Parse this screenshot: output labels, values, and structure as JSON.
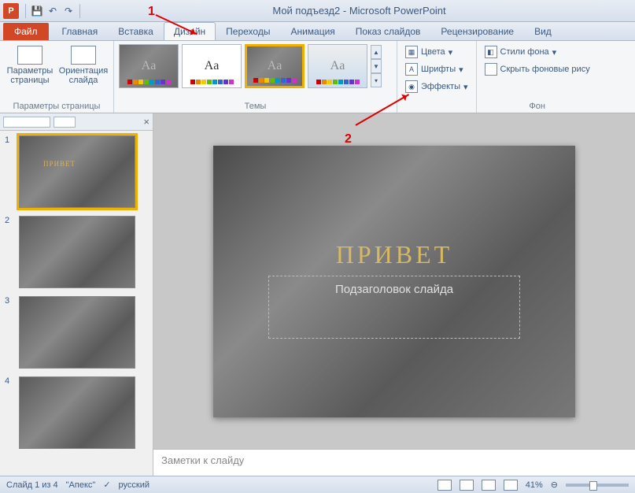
{
  "title": {
    "doc": "Мой подъезд2",
    "app": "Microsoft PowerPoint"
  },
  "qat": {
    "save": "save",
    "undo": "undo",
    "redo": "redo"
  },
  "tabs": {
    "file": "Файл",
    "items": [
      "Главная",
      "Вставка",
      "Дизайн",
      "Переходы",
      "Анимация",
      "Показ слайдов",
      "Рецензирование",
      "Вид"
    ],
    "active": 2
  },
  "ribbon": {
    "page_setup": {
      "params": "Параметры\nстраницы",
      "orient": "Ориентация\nслайда",
      "label": "Параметры страницы"
    },
    "themes": {
      "label": "Темы",
      "aa": "Aa"
    },
    "theme_opts": {
      "colors": "Цвета",
      "fonts": "Шрифты",
      "effects": "Эффекты"
    },
    "background": {
      "styles": "Стили фона",
      "hide": "Скрыть фоновые рису",
      "label": "Фон"
    }
  },
  "thumbs": {
    "count": 4,
    "slide1_title": "ПРИВЕТ"
  },
  "slide": {
    "title": "ПРИВЕТ",
    "subtitle": "Подзаголовок слайда"
  },
  "notes": {
    "placeholder": "Заметки к слайду"
  },
  "status": {
    "slide_info": "Слайд 1 из 4",
    "theme": "\"Апекс\"",
    "lang": "русский",
    "zoom": "41%"
  },
  "annotations": {
    "n1": "1",
    "n2": "2"
  }
}
